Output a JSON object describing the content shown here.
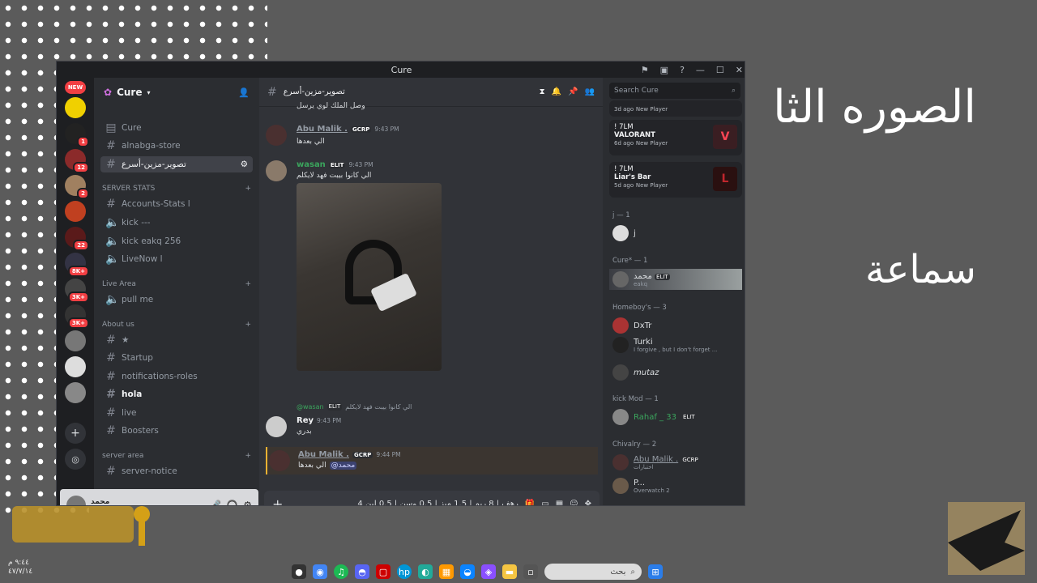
{
  "overlay": {
    "title": "الصوره الثا",
    "subtitle": "سماعة"
  },
  "window": {
    "title": "Cure"
  },
  "servers": {
    "new_badge": "NEW",
    "badges": [
      "1",
      "12",
      "2",
      "22",
      "8K+",
      "3K+",
      "3K+"
    ]
  },
  "guild": {
    "name": "Cure",
    "channels": [
      {
        "label": "Cure",
        "icon": "rules-icon"
      },
      {
        "label": "alnabga-store",
        "icon": "hash-icon"
      },
      {
        "label": "تصوير-مزين-أسرع",
        "icon": "hash-icon"
      }
    ],
    "cat_server_stats": "SERVER STATS",
    "stats_channels": [
      "Accounts-Stats ا",
      "kick ---",
      "kick eakq 256",
      "LiveNow ا"
    ],
    "cat_live_area": "Live Area",
    "live_channels": [
      "pull me"
    ],
    "cat_about_us": "About us",
    "about_channels": [
      "★",
      "Startup",
      "notifications-roles",
      "hola",
      "live",
      "Boosters"
    ],
    "cat_server_area": "server area",
    "server_area_channels": [
      "server-notice"
    ]
  },
  "user": {
    "name": "محمد",
    "status": "eakq"
  },
  "chat": {
    "channel_name": "تصوير-مزين-أسرع",
    "top_text": "وصل الملك لوي يرسل",
    "messages": [
      {
        "author": "Abu Malik .",
        "tag": "GCRP",
        "time": "9:43 PM",
        "text": "الي بعدها"
      },
      {
        "author": "wasan",
        "tag": "ELIT",
        "time": "9:43 PM",
        "text": "الي كانوا بيبت فهد لايكلم"
      },
      {
        "reply_author": "@wasan",
        "reply_tag": "ELIT",
        "reply_text": "الي كانوا بيبت فهد لايكلم",
        "author": "Rey",
        "time": "9:43 PM",
        "text": "بدري"
      },
      {
        "author": "Abu Malik .",
        "tag": "GCRP",
        "time": "9:44 PM",
        "text": "الي بعدها",
        "mention": "@محمد"
      }
    ],
    "input_text": "4 رهف | 8 ريم | 1.5 ميز | 0.5 وسن | 0.5 لين"
  },
  "members": {
    "search_placeholder": "Search Cure",
    "activities": [
      {
        "user": "! 7LM",
        "game": "",
        "meta": "3d ago",
        "status": "New Player",
        "color": "#3a6ea5"
      },
      {
        "user": "! 7LM",
        "game": "VALORANT",
        "meta": "6d ago",
        "status": "New Player",
        "color": "#ff4655"
      },
      {
        "user": "! 7LM",
        "game": "Liar's Bar",
        "meta": "5d ago",
        "status": "New Player",
        "color": "#c0262d"
      }
    ],
    "groups": [
      {
        "title": "j — 1",
        "members": [
          {
            "name": "j",
            "sub": ""
          }
        ]
      },
      {
        "title": "Cure* — 1",
        "members": [
          {
            "name": "محمد",
            "sub": "eakq",
            "tag": "ELIT"
          }
        ]
      },
      {
        "title": "Homeboy's — 3",
        "members": [
          {
            "name": "DxTr",
            "sub": ""
          },
          {
            "name": "Turki",
            "sub": "I forgive , but I don't forget ..."
          },
          {
            "name": "mutaz",
            "sub": ""
          }
        ]
      },
      {
        "title": "kick Mod — 1",
        "members": [
          {
            "name": "Rahaf _ 33",
            "sub": "",
            "tag": "ELIT"
          }
        ]
      },
      {
        "title": "Chivalry — 2",
        "members": [
          {
            "name": "Abu Malik .",
            "sub": "اختبارات",
            "tag": "GCRP"
          },
          {
            "name": "P...",
            "sub": "Overwatch 2"
          }
        ]
      }
    ]
  },
  "taskbar": {
    "search_label": "بحث"
  },
  "clock": {
    "time": "٩:٤٤ م",
    "date": "٤٧/٧/١٤"
  }
}
